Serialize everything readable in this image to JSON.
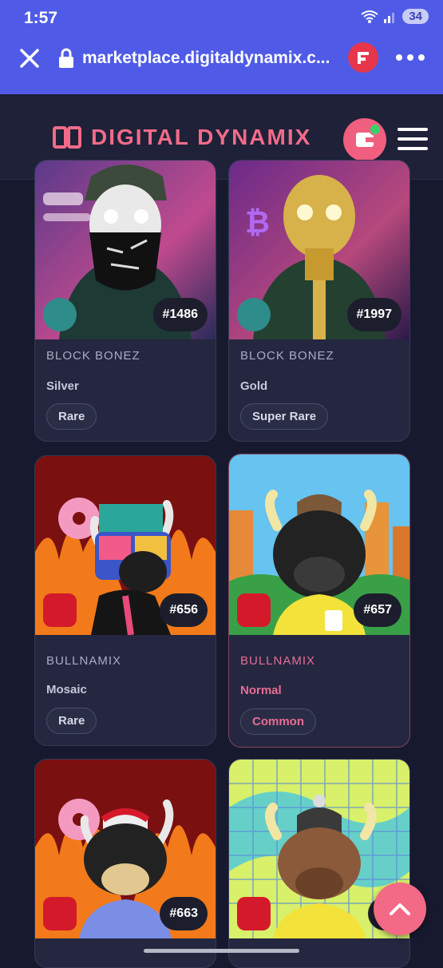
{
  "status": {
    "time": "1:57",
    "battery": "34"
  },
  "browser": {
    "url": "marketplace.digitaldynamix.c..."
  },
  "site": {
    "logo_text": "DIGITAL DYNAMIX"
  },
  "cards": [
    {
      "id": "#1486",
      "collection": "BLOCK BONEZ",
      "tier": "Silver",
      "rarity": "Rare"
    },
    {
      "id": "#1997",
      "collection": "BLOCK BONEZ",
      "tier": "Gold",
      "rarity": "Super Rare"
    },
    {
      "id": "#656",
      "collection": "BULLNAMIX",
      "tier": "Mosaic",
      "rarity": "Rare"
    },
    {
      "id": "#657",
      "collection": "BULLNAMIX",
      "tier": "Normal",
      "rarity": "Common"
    },
    {
      "id": "#663"
    },
    {
      "id": "#6"
    }
  ],
  "colors": {
    "accent": "#f26b89",
    "browser_bar": "#4f5be6",
    "page_bg": "#171a2e"
  }
}
